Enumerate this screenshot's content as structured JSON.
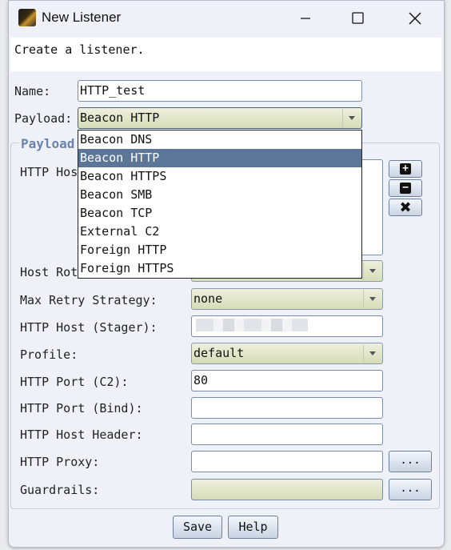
{
  "window": {
    "title": "New Listener",
    "description": "Create a listener."
  },
  "form": {
    "name_label": "Name:",
    "name_value": "HTTP_test",
    "payload_label": "Payload:",
    "payload_value": "Beacon HTTP",
    "group_title": "Payload",
    "http_hosts_label": "HTTP Hos",
    "host_rotation_label": "Host Rot",
    "max_retry_label": "Max Retry Strategy:",
    "max_retry_value": "none",
    "http_host_stager_label": "HTTP Host (Stager):",
    "profile_label": "Profile:",
    "profile_value": "default",
    "http_port_c2_label": "HTTP Port (C2):",
    "http_port_c2_value": "80",
    "http_port_bind_label": "HTTP Port (Bind):",
    "http_port_bind_value": "",
    "http_host_header_label": "HTTP Host Header:",
    "http_host_header_value": "",
    "http_proxy_label": "HTTP Proxy:",
    "http_proxy_value": "",
    "guardrails_label": "Guardrails:",
    "guardrails_value": "",
    "ellipsis": "..."
  },
  "payload_options": [
    "Beacon DNS",
    "Beacon HTTP",
    "Beacon HTTPS",
    "Beacon SMB",
    "Beacon TCP",
    "External C2",
    "Foreign HTTP",
    "Foreign HTTPS"
  ],
  "payload_selected_index": 1,
  "buttons": {
    "save": "Save",
    "help": "Help"
  },
  "icons": {
    "app": "app-icon",
    "minimize": "minimize-icon",
    "maximize": "maximize-icon",
    "close": "close-icon",
    "add": "plus-icon",
    "remove": "minus-icon",
    "clear": "x-icon",
    "dropdown": "chevron-down-icon"
  }
}
